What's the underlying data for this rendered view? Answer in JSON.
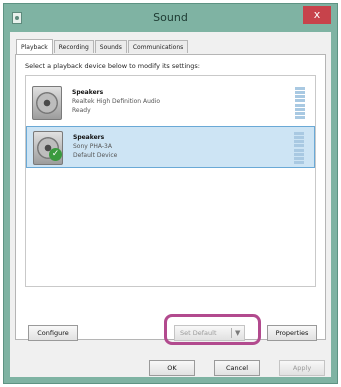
{
  "window": {
    "title": "Sound",
    "close_label": "x"
  },
  "tabs": [
    {
      "label": "Playback",
      "active": true
    },
    {
      "label": "Recording",
      "active": false
    },
    {
      "label": "Sounds",
      "active": false
    },
    {
      "label": "Communications",
      "active": false
    }
  ],
  "playback": {
    "instruction": "Select a playback device below to modify its settings:",
    "devices": [
      {
        "name": "Speakers",
        "description": "Realtek High Definition Audio",
        "status": "Ready",
        "selected": false,
        "is_default": false,
        "icon": "speaker-icon"
      },
      {
        "name": "Speakers",
        "description": "Sony PHA-3A",
        "status": "Default Device",
        "selected": true,
        "is_default": true,
        "icon": "speaker-icon"
      }
    ]
  },
  "buttons": {
    "configure": "Configure",
    "set_default": "Set Default",
    "set_default_arrow": "▼",
    "properties": "Properties",
    "ok": "OK",
    "cancel": "Cancel",
    "apply": "Apply"
  },
  "colors": {
    "titlebar": "#7fb3a3",
    "close_button": "#c7434b",
    "selection": "#cde4f4",
    "highlight_outline": "#b24a8e",
    "default_check": "#3a9a3e"
  }
}
